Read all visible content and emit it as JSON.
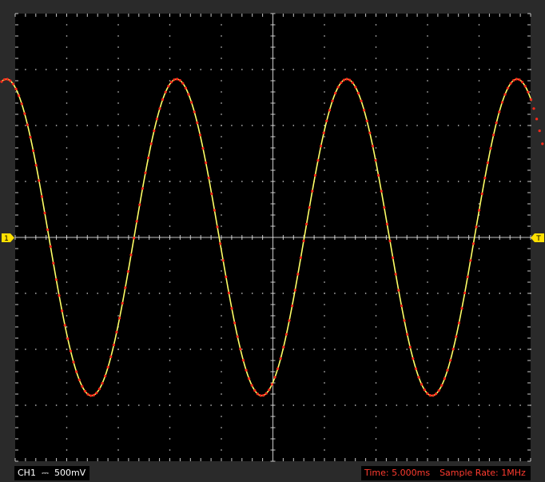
{
  "markers": {
    "channel": "1",
    "trigger": "T"
  },
  "status": {
    "channel": "CH1",
    "coupling_symbol": "⎓",
    "volts_per_div": "500mV",
    "timebase": "Time: 5.000ms",
    "sample_rate": "Sample Rate: 1MHz"
  },
  "colors": {
    "screen_background": "#000000",
    "frame": "#2a2a2a",
    "grid": "#c8c8c8",
    "trace_reference": "#ffff66",
    "trace_samples": "#ff2a1a",
    "marker": "#ffe000"
  },
  "display": {
    "h_divisions": 10,
    "v_divisions": 8,
    "waveform": "sine"
  }
}
